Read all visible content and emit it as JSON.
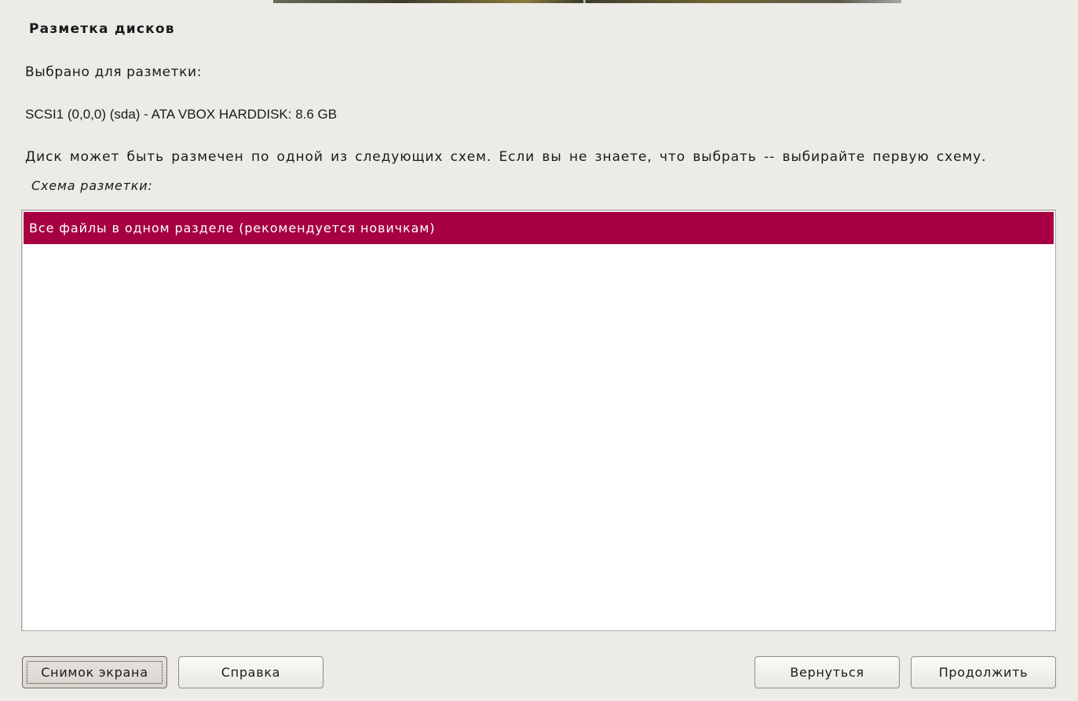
{
  "header": {
    "title": "Разметка дисков"
  },
  "content": {
    "selected_label": "Выбрано для разметки:",
    "disk_name": "SCSI1 (0,0,0) (sda) - ATA VBOX HARDDISK: 8.6 GB",
    "instructions": "Диск может быть размечен по одной из следующих схем. Если вы не знаете, что выбрать -- выбирайте первую схему.",
    "list_label": "Схема разметки:",
    "schemes": [
      {
        "label": "Все файлы в одном разделе (рекомендуется новичкам)",
        "selected": true
      }
    ]
  },
  "buttons": {
    "screenshot": "Снимок экрана",
    "help": "Справка",
    "back": "Вернуться",
    "continue": "Продолжить"
  },
  "colors": {
    "background": "#edebe7",
    "selection": "#a60042",
    "list_background": "#ffffff"
  }
}
